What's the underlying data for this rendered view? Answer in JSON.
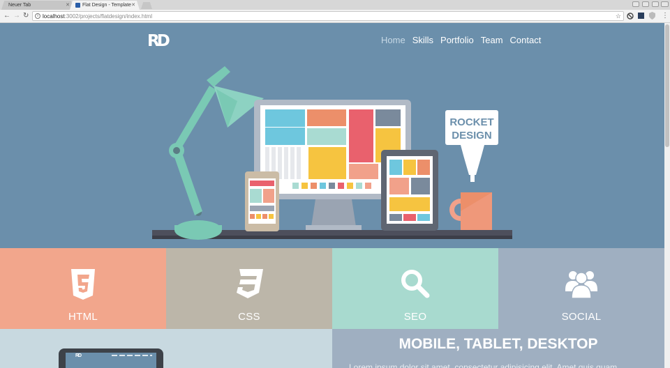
{
  "browser": {
    "tabs": [
      {
        "title": "Neuer Tab",
        "active": false
      },
      {
        "title": "Flat Design - Template",
        "active": true
      }
    ],
    "url_host": "localhost",
    "url_path": ":3002/projects/flatdesign/index.html"
  },
  "site": {
    "logo": "RD",
    "nav": [
      {
        "label": "Home",
        "active": true
      },
      {
        "label": "Skills",
        "active": false
      },
      {
        "label": "Portfolio",
        "active": false
      },
      {
        "label": "Team",
        "active": false
      },
      {
        "label": "Contact",
        "active": false
      }
    ],
    "hero": {
      "sign_line1": "ROCKET",
      "sign_line2": "DESIGN"
    },
    "features": [
      {
        "label": "HTML",
        "icon": "html5-icon",
        "color": "#f2a68c"
      },
      {
        "label": "CSS",
        "icon": "css3-icon",
        "color": "#bcb6a9"
      },
      {
        "label": "SEO",
        "icon": "search-icon",
        "color": "#a8dacf"
      },
      {
        "label": "SOCIAL",
        "icon": "users-icon",
        "color": "#9fafc1"
      }
    ],
    "devices": {
      "title": "MOBILE, TABLET, DESKTOP",
      "text": "Lorem ipsum dolor sit amet, consectetur adipisicing elit. Amet quis quam"
    },
    "colors": {
      "hero_bg": "#6b8fab",
      "html": "#f2a68c",
      "css": "#bcb6a9",
      "seo": "#a8dacf",
      "social": "#9fafc1"
    }
  }
}
